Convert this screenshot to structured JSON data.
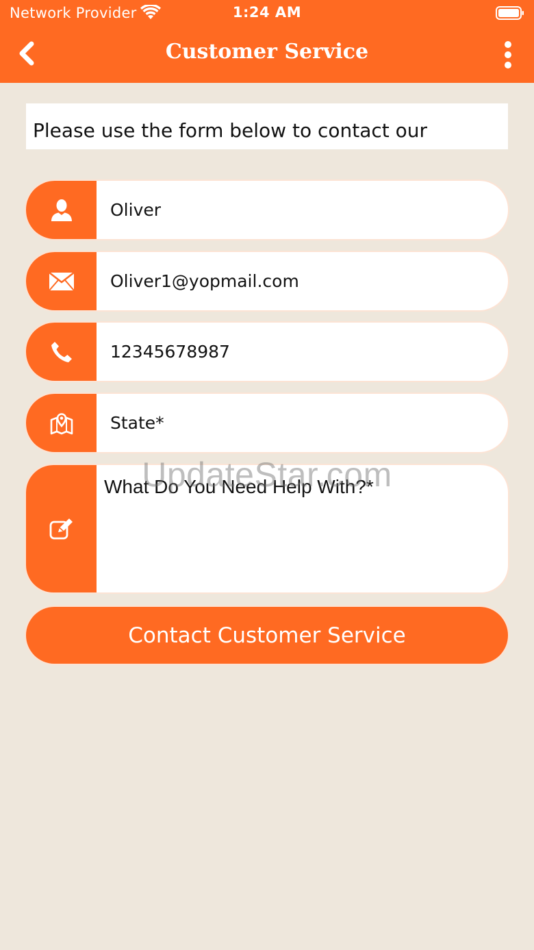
{
  "status_bar": {
    "carrier": "Network Provider",
    "time": "1:24 AM"
  },
  "navbar": {
    "title": "Customer Service"
  },
  "intro": {
    "text": "Please use the form below to contact our customer service team with any questions."
  },
  "form": {
    "name_value": "Oliver",
    "email_value": "Oliver1@yopmail.com",
    "phone_value": "12345678987",
    "state_placeholder": "State*",
    "help_placeholder": "What Do You Need Help With?*"
  },
  "submit_label": "Contact Customer Service",
  "watermark": "UpdateStar.com",
  "colors": {
    "accent": "#FF6A22",
    "background": "#EEE7DC",
    "field_bg": "#FFFFFF"
  },
  "icons": {
    "back": "chevron-left-icon",
    "more": "more-vertical-icon",
    "name": "user-icon",
    "email": "envelope-icon",
    "phone": "phone-icon",
    "state": "map-pin-icon",
    "help": "edit-icon"
  }
}
